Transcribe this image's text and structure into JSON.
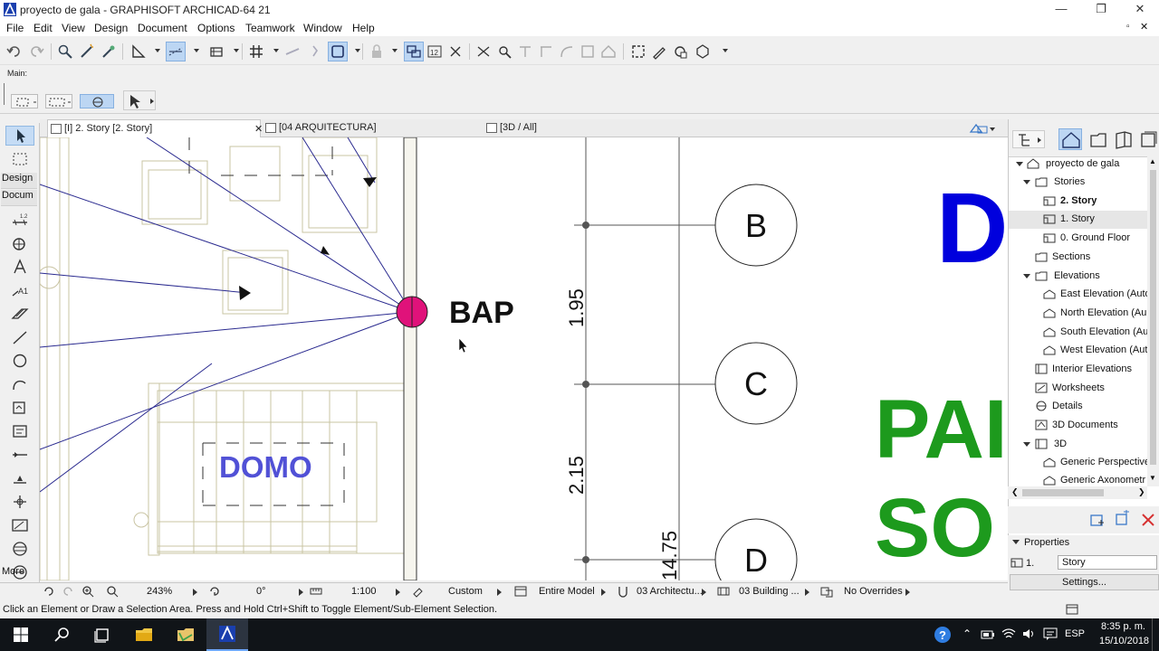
{
  "window": {
    "title": "proyecto de gala - GRAPHISOFT ARCHICAD-64 21"
  },
  "menu": [
    "File",
    "Edit",
    "View",
    "Design",
    "Document",
    "Options",
    "Teamwork",
    "Window",
    "Help"
  ],
  "toolbar2": {
    "label": "Main:"
  },
  "toolbox": {
    "design_tab": "Design",
    "document_tab": "Docum",
    "more": "More"
  },
  "tabs": [
    {
      "label": "[I] 2. Story [2. Story]"
    },
    {
      "label": "[04 ARQUITECTURA]"
    },
    {
      "label": "[3D / All]"
    }
  ],
  "drawing": {
    "label_bap": "BAP",
    "label_domo": "DOMO",
    "grid_bubbles": [
      "B",
      "C",
      "D"
    ],
    "dimensions": [
      "1.95",
      "2.15",
      "14.75"
    ],
    "big_letters": {
      "blue": "D",
      "green1": "PAI",
      "green2": "SO"
    }
  },
  "navigator": {
    "items": [
      {
        "label": "proyecto de gala"
      },
      {
        "label": "Stories"
      },
      {
        "label": "2. Story"
      },
      {
        "label": "1. Story"
      },
      {
        "label": "0. Ground Floor"
      },
      {
        "label": "Sections"
      },
      {
        "label": "Elevations"
      },
      {
        "label": "East Elevation (Auto"
      },
      {
        "label": "North Elevation (Au"
      },
      {
        "label": "South Elevation (Au"
      },
      {
        "label": "West Elevation (Aut"
      },
      {
        "label": "Interior Elevations"
      },
      {
        "label": "Worksheets"
      },
      {
        "label": "Details"
      },
      {
        "label": "3D Documents"
      },
      {
        "label": "3D"
      },
      {
        "label": "Generic Perspective"
      },
      {
        "label": "Generic Axonometr"
      }
    ]
  },
  "properties": {
    "header": "Properties",
    "id": "1.",
    "value": "Story",
    "settings": "Settings..."
  },
  "bottombar": {
    "zoom": "243%",
    "angle": "0°",
    "scale": "1:100",
    "pen": "Custom",
    "model": "Entire Model",
    "layer": "03 Architectu...",
    "structure": "03 Building ...",
    "overrides": "No Overrides"
  },
  "status": {
    "text": "Click an Element or Draw a Selection Area. Press and Hold Ctrl+Shift to Toggle Element/Sub-Element Selection."
  },
  "taskbar": {
    "lang": "ESP",
    "time": "8:35 p. m.",
    "date": "15/10/2018"
  }
}
